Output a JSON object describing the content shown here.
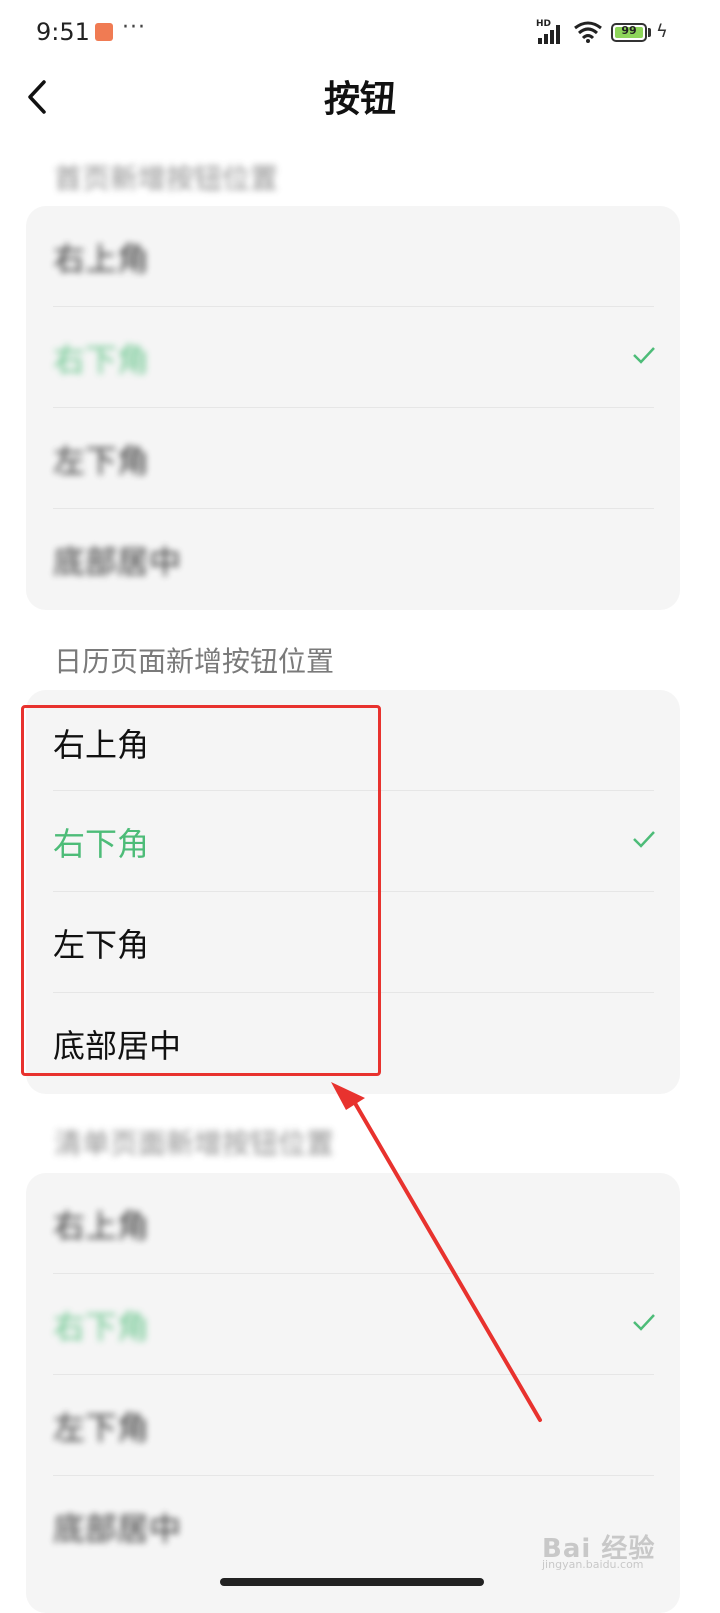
{
  "status_bar": {
    "time": "9:51",
    "more": "···",
    "hd": "HD",
    "battery": "99"
  },
  "header": {
    "title": "按钮"
  },
  "sections": [
    {
      "title": "首页新增按钮位置",
      "blurred": true,
      "items": [
        {
          "label": "右上角",
          "selected": false
        },
        {
          "label": "右下角",
          "selected": true
        },
        {
          "label": "左下角",
          "selected": false
        },
        {
          "label": "底部居中",
          "selected": false
        }
      ]
    },
    {
      "title": "日历页面新增按钮位置",
      "blurred": false,
      "items": [
        {
          "label": "右上角",
          "selected": false
        },
        {
          "label": "右下角",
          "selected": true
        },
        {
          "label": "左下角",
          "selected": false
        },
        {
          "label": "底部居中",
          "selected": false
        }
      ]
    },
    {
      "title": "清单页面新增按钮位置",
      "blurred": true,
      "items": [
        {
          "label": "右上角",
          "selected": false
        },
        {
          "label": "右下角",
          "selected": true
        },
        {
          "label": "左下角",
          "selected": false
        },
        {
          "label": "底部居中",
          "selected": false
        }
      ]
    }
  ],
  "watermark": {
    "text": "Bai 经验",
    "sub": "jingyan.baidu.com"
  },
  "colors": {
    "accent": "#4dbc78",
    "annotation": "#e8322e"
  }
}
